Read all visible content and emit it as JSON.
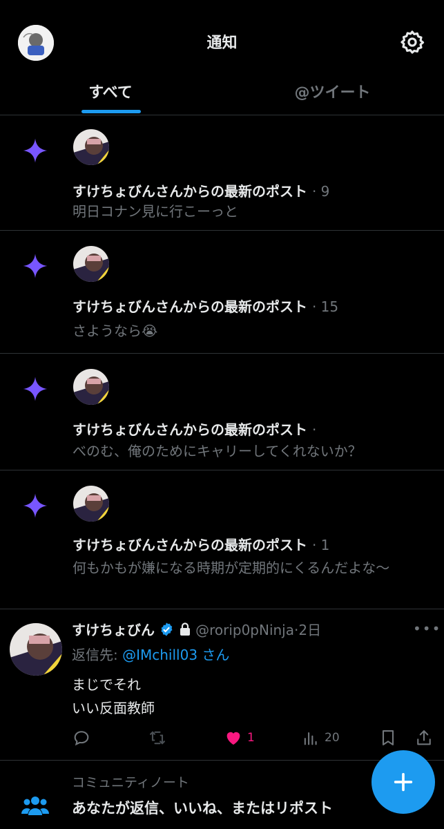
{
  "header": {
    "title": "通知"
  },
  "tabs": [
    {
      "label": "すべて"
    },
    {
      "label": "@ツイート"
    }
  ],
  "notifications": [
    {
      "title": "すけちょびんさんからの最新のポスト",
      "time": "· 9",
      "body": "明日コナン見に行こーっと"
    },
    {
      "title": "すけちょびんさんからの最新のポスト",
      "time": "· 15",
      "body": "さようなら😭"
    },
    {
      "title": "すけちょびんさんからの最新のポスト",
      "time": "·",
      "body": "べのむ、俺のためにキャリーしてくれないか？"
    },
    {
      "title": "すけちょびんさんからの最新のポスト",
      "time": "· 1",
      "body": "何もかもが嫌になる時期が定期的にくるんだよな～"
    }
  ],
  "tweet": {
    "name": "すけちょびん",
    "handle": "@rorip0pNinja",
    "time": "·2日",
    "reply_prefix": "返信先: ",
    "reply_to": "@IMchill03 さん",
    "line1": "まじでそれ",
    "line2": "いい反面教師",
    "likes": "1",
    "views": "20"
  },
  "community_note": {
    "label": "コミュニティノート",
    "text": "あなたが返信、いいね、またはリポスト"
  }
}
